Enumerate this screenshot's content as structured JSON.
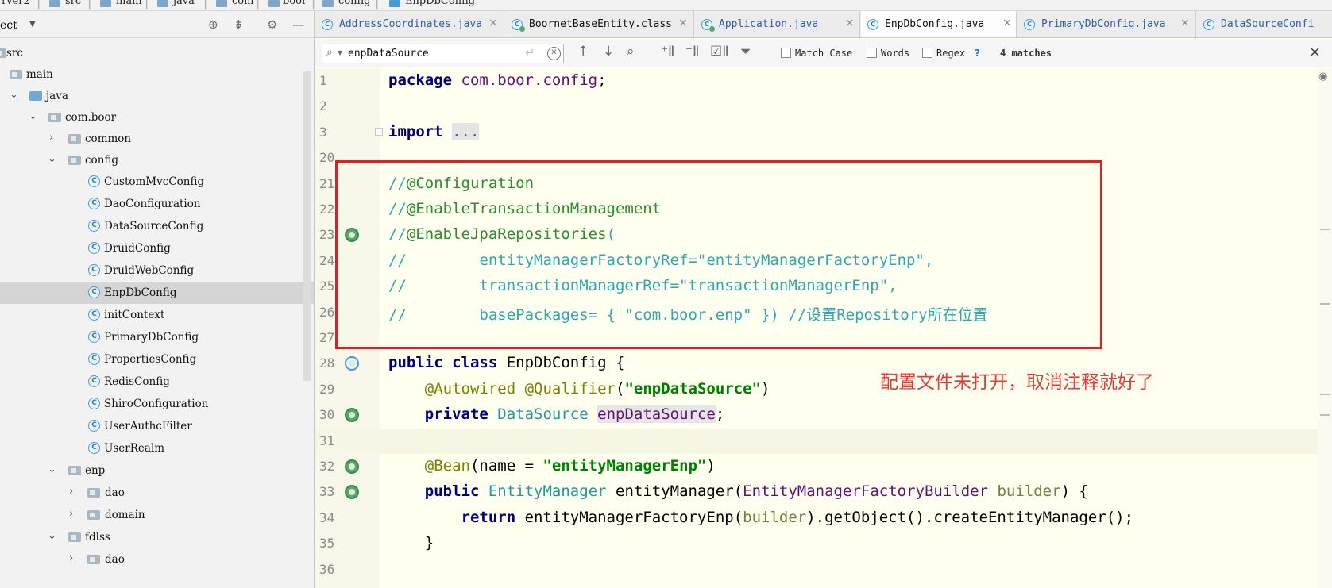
{
  "breadcrumbs": [
    "rver2",
    "src",
    "main",
    "java",
    "com",
    "boor",
    "config",
    "EnpDbConfig"
  ],
  "project_panel": {
    "title": "ect",
    "tree": [
      {
        "label": "src",
        "kind": "folder",
        "expanded": true
      },
      {
        "label": "main",
        "kind": "folder",
        "expanded": true
      },
      {
        "label": "java",
        "kind": "source-folder",
        "expanded": true
      },
      {
        "label": "com.boor",
        "kind": "package",
        "expanded": true
      },
      {
        "label": "common",
        "kind": "package",
        "expanded": false
      },
      {
        "label": "config",
        "kind": "package",
        "expanded": true
      },
      {
        "label": "CustomMvcConfig",
        "kind": "class"
      },
      {
        "label": "DaoConfiguration",
        "kind": "class"
      },
      {
        "label": "DataSourceConfig",
        "kind": "class"
      },
      {
        "label": "DruidConfig",
        "kind": "class"
      },
      {
        "label": "DruidWebConfig",
        "kind": "class"
      },
      {
        "label": "EnpDbConfig",
        "kind": "class",
        "selected": true
      },
      {
        "label": "initContext",
        "kind": "class"
      },
      {
        "label": "PrimaryDbConfig",
        "kind": "class"
      },
      {
        "label": "PropertiesConfig",
        "kind": "class"
      },
      {
        "label": "RedisConfig",
        "kind": "class"
      },
      {
        "label": "ShiroConfiguration",
        "kind": "class"
      },
      {
        "label": "UserAuthcFilter",
        "kind": "class"
      },
      {
        "label": "UserRealm",
        "kind": "class"
      },
      {
        "label": "enp",
        "kind": "package",
        "expanded": true
      },
      {
        "label": "dao",
        "kind": "package",
        "expanded": false
      },
      {
        "label": "domain",
        "kind": "package",
        "expanded": false
      },
      {
        "label": "fdlss",
        "kind": "package",
        "expanded": true
      },
      {
        "label": "dao",
        "kind": "package",
        "expanded": false
      }
    ]
  },
  "tabs": [
    {
      "label": "AddressCoordinates.java",
      "icon": "class-icon"
    },
    {
      "label": "BoornetBaseEntity.class",
      "icon": "class-file-icon"
    },
    {
      "label": "Application.java",
      "icon": "run-class-icon"
    },
    {
      "label": "EnpDbConfig.java",
      "icon": "class-icon",
      "active": true
    },
    {
      "label": "PrimaryDbConfig.java",
      "icon": "class-icon"
    },
    {
      "label": "DataSourceConfi",
      "icon": "class-icon"
    }
  ],
  "find_bar": {
    "query": "enpDataSource",
    "match_case_label": "Match Case",
    "words_label": "Words",
    "regex_label": "Regex",
    "help_label": "?",
    "matches_label": "4 matches"
  },
  "code_lines": [
    {
      "n": "1",
      "text": "package com.boor.config;"
    },
    {
      "n": "2",
      "text": ""
    },
    {
      "n": "3",
      "text": "import ..."
    },
    {
      "n": "20",
      "text": ""
    },
    {
      "n": "21",
      "text": "//@Configuration"
    },
    {
      "n": "22",
      "text": "//@EnableTransactionManagement"
    },
    {
      "n": "23",
      "text": "//@EnableJpaRepositories("
    },
    {
      "n": "24",
      "text": "//        entityManagerFactoryRef=\"entityManagerFactoryEnp\","
    },
    {
      "n": "25",
      "text": "//        transactionManagerRef=\"transactionManagerEnp\","
    },
    {
      "n": "26",
      "text": "//        basePackages= { \"com.boor.enp\" }) //设置Repository所在位置"
    },
    {
      "n": "27",
      "text": ""
    },
    {
      "n": "28",
      "text": "public class EnpDbConfig {"
    },
    {
      "n": "29",
      "text": "    @Autowired @Qualifier(\"enpDataSource\")"
    },
    {
      "n": "30",
      "text": "    private DataSource enpDataSource;"
    },
    {
      "n": "31",
      "text": ""
    },
    {
      "n": "32",
      "text": "    @Bean(name = \"entityManagerEnp\")"
    },
    {
      "n": "33",
      "text": "    public EntityManager entityManager(EntityManagerFactoryBuilder builder) {"
    },
    {
      "n": "34",
      "text": "        return entityManagerFactoryEnp(builder).getObject().createEntityManager();"
    },
    {
      "n": "35",
      "text": "    }"
    },
    {
      "n": "36",
      "text": ""
    }
  ],
  "annotation_note": "配置文件未打开，取消注释就好了",
  "colors": {
    "highlight_box": "#e02020",
    "note_text": "#e53935",
    "editor_bg": "#fffff0"
  }
}
